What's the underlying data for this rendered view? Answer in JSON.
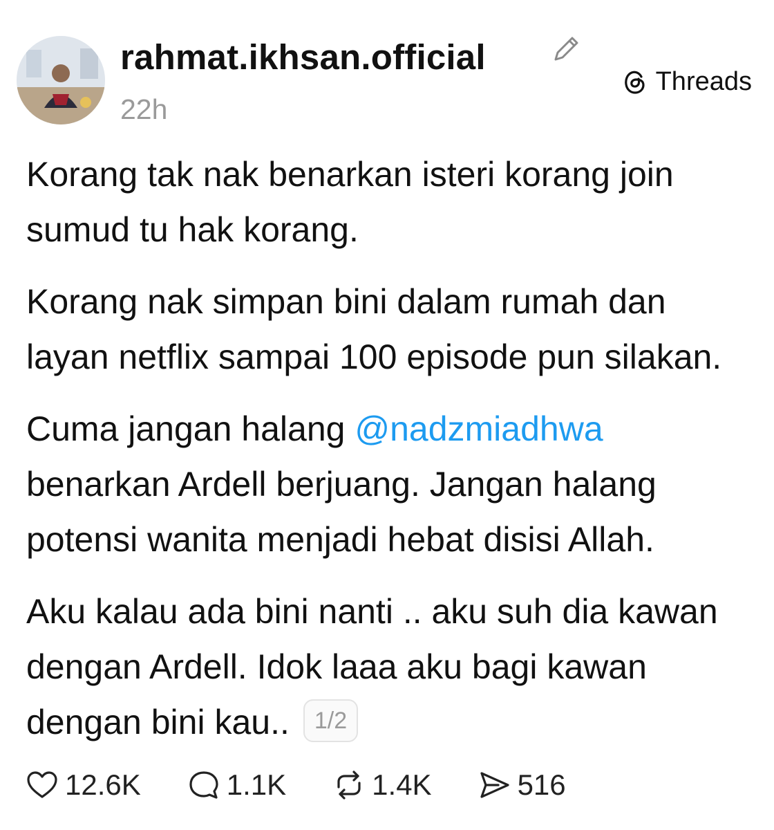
{
  "post": {
    "username": "rahmat.ikhsan.official",
    "timestamp": "22h",
    "paragraphs": {
      "p1": "Korang tak nak benarkan isteri korang join sumud tu hak korang.",
      "p2": "Korang nak simpan bini dalam rumah dan layan netflix sampai 100 episode pun silakan.",
      "p3_before": "Cuma jangan halang ",
      "p3_mention": "@nadzmiadhwa",
      "p3_after": " benarkan Ardell berjuang. Jangan halang potensi wanita menjadi hebat disisi Allah.",
      "p4": "Aku kalau ada bini nanti .. aku suh dia kawan dengan Ardell. Idok laaa aku bagi kawan dengan bini kau.."
    },
    "page_badge": "1/2"
  },
  "brand": {
    "label": "Threads"
  },
  "actions": {
    "likes": "12.6K",
    "replies": "1.1K",
    "reposts": "1.4K",
    "shares": "516"
  },
  "colors": {
    "mention": "#1d9bf0",
    "muted": "#9a9a9a",
    "text": "#111111"
  },
  "icons": [
    "edit-icon",
    "threads-logo-icon",
    "heart-icon",
    "comment-icon",
    "repost-icon",
    "share-icon"
  ]
}
